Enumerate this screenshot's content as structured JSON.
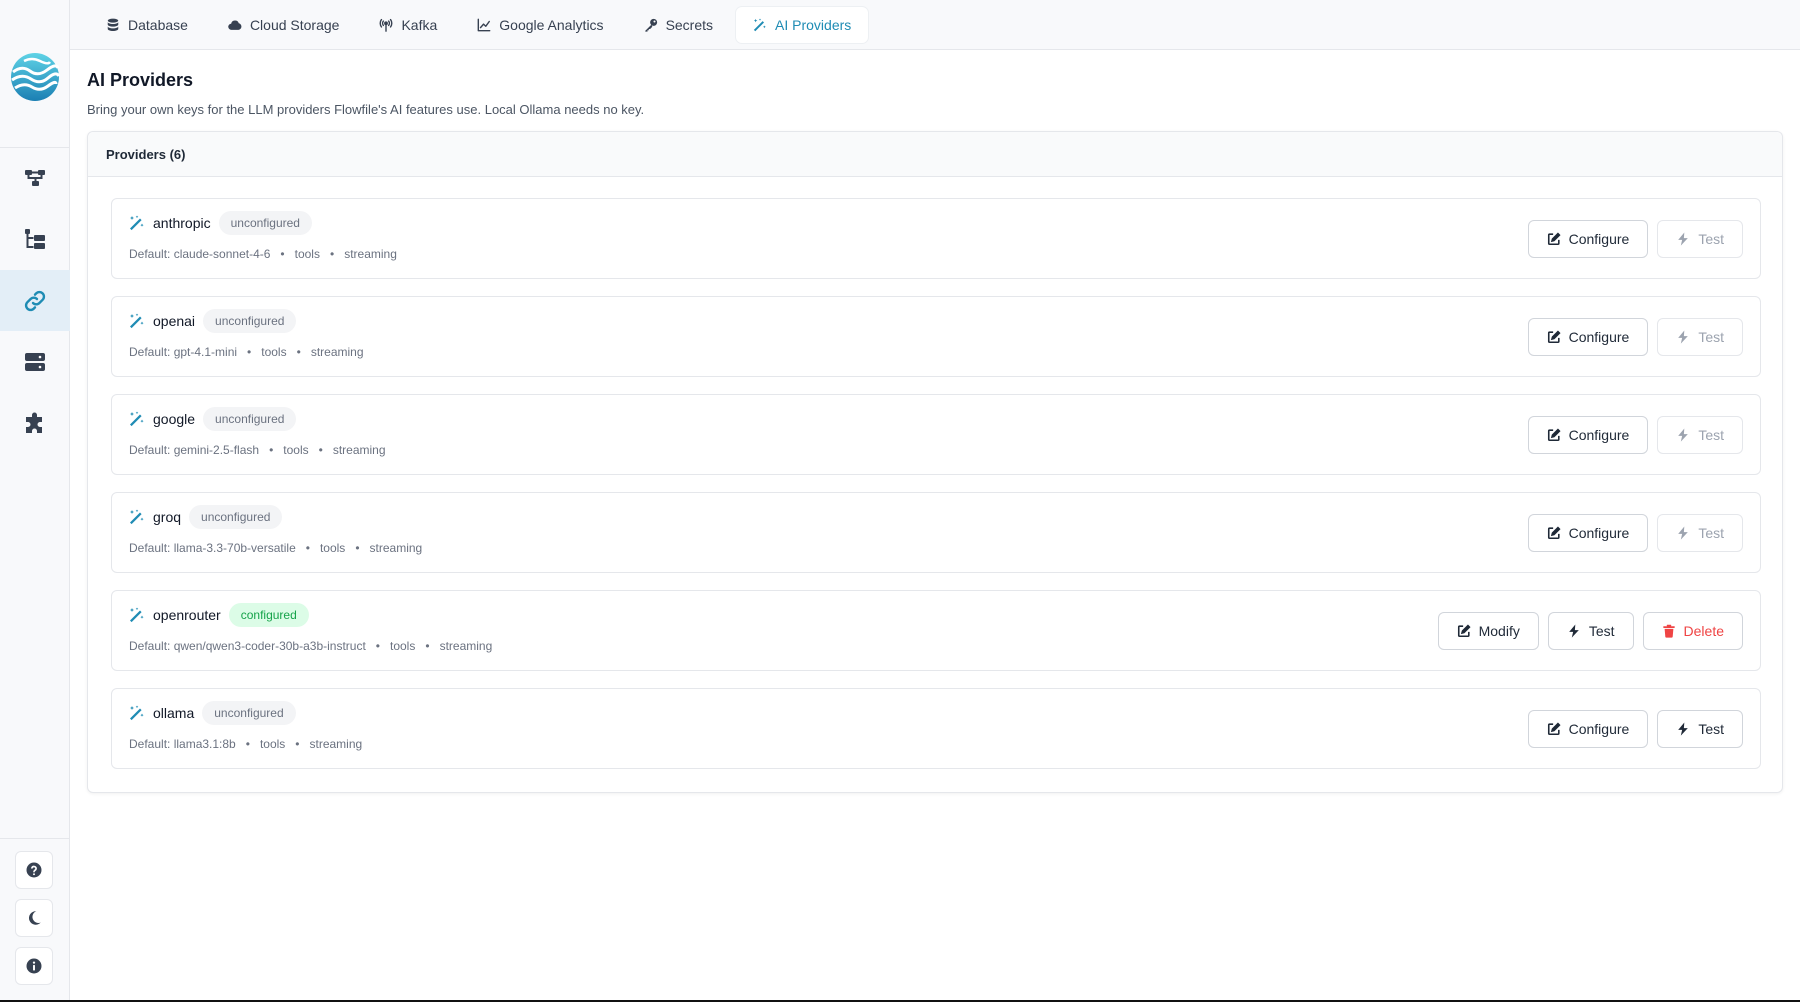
{
  "colors": {
    "accent": "#1f8cb4",
    "configured_bg": "#dcfce7",
    "configured_text": "#16a34a",
    "danger": "#ef4444"
  },
  "sidebar": {
    "logo": "flowfile-wave-logo",
    "nav_items": [
      {
        "name": "flows",
        "icon": "flow-diagram-icon"
      },
      {
        "name": "catalog",
        "icon": "folder-tree-icon"
      },
      {
        "name": "connections",
        "icon": "link-icon",
        "active": true
      },
      {
        "name": "storage",
        "icon": "server-icon"
      },
      {
        "name": "plugins",
        "icon": "puzzle-icon"
      }
    ],
    "bottom_buttons": [
      {
        "name": "help",
        "icon": "question-circle-icon"
      },
      {
        "name": "theme",
        "icon": "moon-icon"
      },
      {
        "name": "info",
        "icon": "info-circle-icon"
      }
    ]
  },
  "tabs": [
    {
      "label": "Database",
      "icon": "database-icon"
    },
    {
      "label": "Cloud Storage",
      "icon": "cloud-icon"
    },
    {
      "label": "Kafka",
      "icon": "broadcast-icon"
    },
    {
      "label": "Google Analytics",
      "icon": "chart-line-icon"
    },
    {
      "label": "Secrets",
      "icon": "key-icon"
    },
    {
      "label": "AI Providers",
      "icon": "magic-wand-icon",
      "active": true
    }
  ],
  "page": {
    "title": "AI Providers",
    "subtitle": "Bring your own keys for the LLM providers Flowfile's AI features use. Local Ollama needs no key."
  },
  "card": {
    "header": "Providers (6)"
  },
  "providers": [
    {
      "name": "anthropic",
      "status": "unconfigured",
      "default": "Default: claude-sonnet-4-6",
      "cap1": "tools",
      "cap2": "streaming",
      "configure_label": "Configure",
      "test_label": "Test"
    },
    {
      "name": "openai",
      "status": "unconfigured",
      "default": "Default: gpt-4.1-mini",
      "cap1": "tools",
      "cap2": "streaming",
      "configure_label": "Configure",
      "test_label": "Test"
    },
    {
      "name": "google",
      "status": "unconfigured",
      "default": "Default: gemini-2.5-flash",
      "cap1": "tools",
      "cap2": "streaming",
      "configure_label": "Configure",
      "test_label": "Test"
    },
    {
      "name": "groq",
      "status": "unconfigured",
      "default": "Default: llama-3.3-70b-versatile",
      "cap1": "tools",
      "cap2": "streaming",
      "configure_label": "Configure",
      "test_label": "Test"
    },
    {
      "name": "openrouter",
      "status": "configured",
      "default": "Default: qwen/qwen3-coder-30b-a3b-instruct",
      "cap1": "tools",
      "cap2": "streaming",
      "modify_label": "Modify",
      "test_label": "Test",
      "delete_label": "Delete"
    },
    {
      "name": "ollama",
      "status": "unconfigured",
      "default": "Default: llama3.1:8b",
      "cap1": "tools",
      "cap2": "streaming",
      "configure_label": "Configure",
      "test_label": "Test"
    }
  ]
}
